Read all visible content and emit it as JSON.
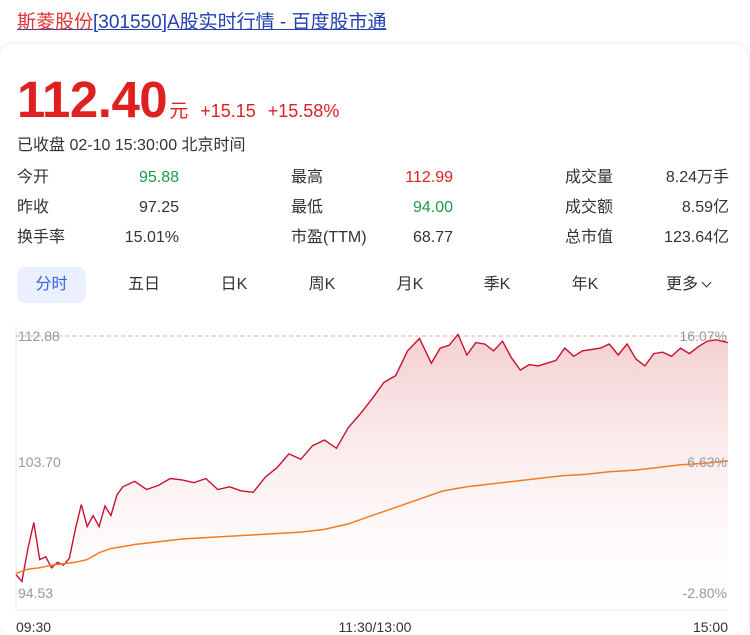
{
  "title": {
    "name": "斯菱股份",
    "rest": "[301550]A股实时行情 - 百度股市通"
  },
  "quote": {
    "price": "112.40",
    "unit": "元",
    "change": "+15.15",
    "change_pct": "+15.58%",
    "status": "已收盘 02-10 15:30:00 北京时间"
  },
  "stats": {
    "open": {
      "label": "今开",
      "value": "95.88"
    },
    "prev_close": {
      "label": "昨收",
      "value": "97.25"
    },
    "turnover": {
      "label": "换手率",
      "value": "15.01%"
    },
    "high": {
      "label": "最高",
      "value": "112.99"
    },
    "low": {
      "label": "最低",
      "value": "94.00"
    },
    "pe": {
      "label": "市盈(TTM)",
      "value": "68.77"
    },
    "volume": {
      "label": "成交量",
      "value": "8.24万手"
    },
    "amount": {
      "label": "成交额",
      "value": "8.59亿"
    },
    "market_cap": {
      "label": "总市值",
      "value": "123.64亿"
    }
  },
  "tabs": [
    "分时",
    "五日",
    "日K",
    "周K",
    "月K",
    "季K",
    "年K",
    "更多"
  ],
  "active_tab": "分时",
  "colors": {
    "up": "#e02020",
    "down": "#1a9a4a",
    "avg_line": "#f07c22",
    "link": "#2440b3",
    "tab_active": "#3a62e8"
  },
  "chart_data": {
    "type": "line",
    "y_left_ticks": [
      "112.88",
      "103.70",
      "94.53"
    ],
    "y_right_ticks": [
      "16.07%",
      "6.63%",
      "-2.80%"
    ],
    "x_ticks": [
      "09:30",
      "11:30/13:00",
      "15:00"
    ],
    "ylim": [
      94.53,
      112.88
    ],
    "reference_line": 112.88,
    "x_minutes_total": 240,
    "series": [
      {
        "role": "price",
        "x": [
          0,
          2,
          4,
          6,
          8,
          10,
          12,
          14,
          16,
          18,
          20,
          22,
          24,
          26,
          28,
          30,
          32,
          34,
          36,
          40,
          44,
          48,
          52,
          56,
          60,
          64,
          68,
          72,
          76,
          80,
          84,
          88,
          92,
          96,
          100,
          104,
          108,
          112,
          116,
          120,
          124,
          128,
          132,
          136,
          140,
          143,
          146,
          149,
          152,
          155,
          158,
          161,
          164,
          167,
          170,
          173,
          176,
          179,
          182,
          185,
          188,
          191,
          194,
          197,
          200,
          203,
          206,
          209,
          212,
          215,
          218,
          221,
          224,
          227,
          230,
          233,
          236,
          240
        ],
        "y": [
          95.5,
          95.0,
          97.4,
          99.3,
          96.6,
          96.8,
          96.0,
          96.4,
          96.2,
          96.7,
          98.8,
          100.6,
          99.0,
          99.8,
          99.0,
          100.5,
          99.8,
          101.3,
          101.9,
          102.3,
          101.7,
          102.0,
          102.5,
          102.4,
          102.2,
          102.5,
          101.7,
          101.9,
          101.6,
          101.5,
          102.6,
          103.3,
          104.3,
          103.9,
          104.9,
          105.3,
          104.7,
          106.2,
          107.2,
          108.3,
          109.5,
          110.0,
          111.8,
          112.7,
          110.9,
          112.0,
          112.2,
          113.0,
          111.5,
          112.4,
          112.3,
          111.8,
          112.5,
          111.3,
          110.4,
          110.8,
          110.7,
          110.9,
          111.1,
          112.0,
          111.4,
          111.8,
          111.9,
          112.0,
          112.3,
          111.5,
          112.3,
          111.2,
          110.7,
          111.6,
          111.7,
          111.4,
          112.0,
          111.6,
          112.1,
          112.5,
          112.6,
          112.4
        ]
      },
      {
        "role": "average",
        "x": [
          0,
          4,
          8,
          12,
          16,
          20,
          24,
          28,
          32,
          40,
          48,
          56,
          64,
          72,
          80,
          88,
          96,
          104,
          112,
          120,
          128,
          136,
          144,
          152,
          160,
          168,
          176,
          184,
          192,
          200,
          208,
          216,
          224,
          232,
          240
        ],
        "y": [
          95.6,
          95.9,
          96.0,
          96.2,
          96.3,
          96.4,
          96.6,
          97.1,
          97.4,
          97.7,
          97.9,
          98.1,
          98.2,
          98.3,
          98.4,
          98.5,
          98.6,
          98.8,
          99.2,
          99.8,
          100.4,
          101.0,
          101.6,
          101.9,
          102.1,
          102.3,
          102.5,
          102.7,
          102.8,
          103.0,
          103.1,
          103.3,
          103.5,
          103.6,
          103.8
        ]
      }
    ]
  }
}
